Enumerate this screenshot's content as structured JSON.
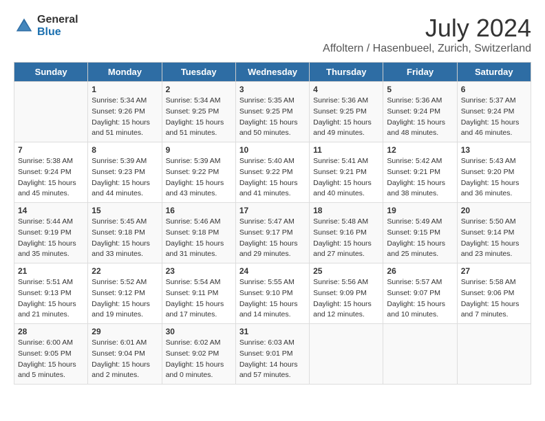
{
  "header": {
    "logo_general": "General",
    "logo_blue": "Blue",
    "main_title": "July 2024",
    "subtitle": "Affoltern / Hasenbueel, Zurich, Switzerland"
  },
  "calendar": {
    "days_of_week": [
      "Sunday",
      "Monday",
      "Tuesday",
      "Wednesday",
      "Thursday",
      "Friday",
      "Saturday"
    ],
    "weeks": [
      [
        {
          "day": "",
          "info": ""
        },
        {
          "day": "1",
          "info": "Sunrise: 5:34 AM\nSunset: 9:26 PM\nDaylight: 15 hours\nand 51 minutes."
        },
        {
          "day": "2",
          "info": "Sunrise: 5:34 AM\nSunset: 9:25 PM\nDaylight: 15 hours\nand 51 minutes."
        },
        {
          "day": "3",
          "info": "Sunrise: 5:35 AM\nSunset: 9:25 PM\nDaylight: 15 hours\nand 50 minutes."
        },
        {
          "day": "4",
          "info": "Sunrise: 5:36 AM\nSunset: 9:25 PM\nDaylight: 15 hours\nand 49 minutes."
        },
        {
          "day": "5",
          "info": "Sunrise: 5:36 AM\nSunset: 9:24 PM\nDaylight: 15 hours\nand 48 minutes."
        },
        {
          "day": "6",
          "info": "Sunrise: 5:37 AM\nSunset: 9:24 PM\nDaylight: 15 hours\nand 46 minutes."
        }
      ],
      [
        {
          "day": "7",
          "info": "Sunrise: 5:38 AM\nSunset: 9:24 PM\nDaylight: 15 hours\nand 45 minutes."
        },
        {
          "day": "8",
          "info": "Sunrise: 5:39 AM\nSunset: 9:23 PM\nDaylight: 15 hours\nand 44 minutes."
        },
        {
          "day": "9",
          "info": "Sunrise: 5:39 AM\nSunset: 9:22 PM\nDaylight: 15 hours\nand 43 minutes."
        },
        {
          "day": "10",
          "info": "Sunrise: 5:40 AM\nSunset: 9:22 PM\nDaylight: 15 hours\nand 41 minutes."
        },
        {
          "day": "11",
          "info": "Sunrise: 5:41 AM\nSunset: 9:21 PM\nDaylight: 15 hours\nand 40 minutes."
        },
        {
          "day": "12",
          "info": "Sunrise: 5:42 AM\nSunset: 9:21 PM\nDaylight: 15 hours\nand 38 minutes."
        },
        {
          "day": "13",
          "info": "Sunrise: 5:43 AM\nSunset: 9:20 PM\nDaylight: 15 hours\nand 36 minutes."
        }
      ],
      [
        {
          "day": "14",
          "info": "Sunrise: 5:44 AM\nSunset: 9:19 PM\nDaylight: 15 hours\nand 35 minutes."
        },
        {
          "day": "15",
          "info": "Sunrise: 5:45 AM\nSunset: 9:18 PM\nDaylight: 15 hours\nand 33 minutes."
        },
        {
          "day": "16",
          "info": "Sunrise: 5:46 AM\nSunset: 9:18 PM\nDaylight: 15 hours\nand 31 minutes."
        },
        {
          "day": "17",
          "info": "Sunrise: 5:47 AM\nSunset: 9:17 PM\nDaylight: 15 hours\nand 29 minutes."
        },
        {
          "day": "18",
          "info": "Sunrise: 5:48 AM\nSunset: 9:16 PM\nDaylight: 15 hours\nand 27 minutes."
        },
        {
          "day": "19",
          "info": "Sunrise: 5:49 AM\nSunset: 9:15 PM\nDaylight: 15 hours\nand 25 minutes."
        },
        {
          "day": "20",
          "info": "Sunrise: 5:50 AM\nSunset: 9:14 PM\nDaylight: 15 hours\nand 23 minutes."
        }
      ],
      [
        {
          "day": "21",
          "info": "Sunrise: 5:51 AM\nSunset: 9:13 PM\nDaylight: 15 hours\nand 21 minutes."
        },
        {
          "day": "22",
          "info": "Sunrise: 5:52 AM\nSunset: 9:12 PM\nDaylight: 15 hours\nand 19 minutes."
        },
        {
          "day": "23",
          "info": "Sunrise: 5:54 AM\nSunset: 9:11 PM\nDaylight: 15 hours\nand 17 minutes."
        },
        {
          "day": "24",
          "info": "Sunrise: 5:55 AM\nSunset: 9:10 PM\nDaylight: 15 hours\nand 14 minutes."
        },
        {
          "day": "25",
          "info": "Sunrise: 5:56 AM\nSunset: 9:09 PM\nDaylight: 15 hours\nand 12 minutes."
        },
        {
          "day": "26",
          "info": "Sunrise: 5:57 AM\nSunset: 9:07 PM\nDaylight: 15 hours\nand 10 minutes."
        },
        {
          "day": "27",
          "info": "Sunrise: 5:58 AM\nSunset: 9:06 PM\nDaylight: 15 hours\nand 7 minutes."
        }
      ],
      [
        {
          "day": "28",
          "info": "Sunrise: 6:00 AM\nSunset: 9:05 PM\nDaylight: 15 hours\nand 5 minutes."
        },
        {
          "day": "29",
          "info": "Sunrise: 6:01 AM\nSunset: 9:04 PM\nDaylight: 15 hours\nand 2 minutes."
        },
        {
          "day": "30",
          "info": "Sunrise: 6:02 AM\nSunset: 9:02 PM\nDaylight: 15 hours\nand 0 minutes."
        },
        {
          "day": "31",
          "info": "Sunrise: 6:03 AM\nSunset: 9:01 PM\nDaylight: 14 hours\nand 57 minutes."
        },
        {
          "day": "",
          "info": ""
        },
        {
          "day": "",
          "info": ""
        },
        {
          "day": "",
          "info": ""
        }
      ]
    ]
  }
}
